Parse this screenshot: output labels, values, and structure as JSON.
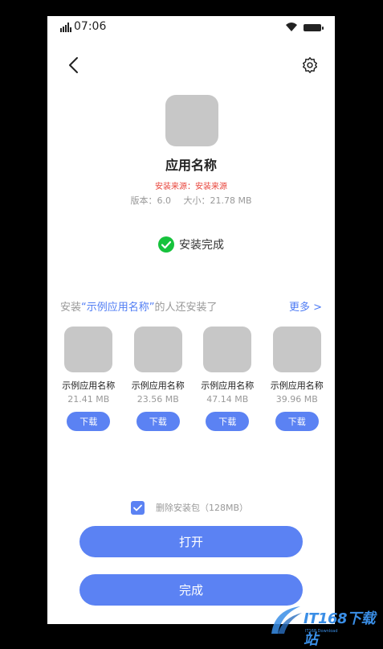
{
  "statusbar": {
    "time": "07:06"
  },
  "app": {
    "name": "应用名称",
    "source": "安装来源：安装来源",
    "version": "版本：6.0",
    "size": "大小：21.78 MB"
  },
  "install_status": "安装完成",
  "recommend": {
    "title_prefix": "安装",
    "title_highlight": "“示例应用名称”",
    "title_suffix": "的人还安装了",
    "more_label": "更多 >",
    "items": [
      {
        "name": "示例应用名称",
        "size": "21.41 MB",
        "button": "下载"
      },
      {
        "name": "示例应用名称",
        "size": "23.56 MB",
        "button": "下载"
      },
      {
        "name": "示例应用名称",
        "size": "47.14 MB",
        "button": "下载"
      },
      {
        "name": "示例应用名称",
        "size": "39.96 MB",
        "button": "下载"
      }
    ]
  },
  "delete_package": {
    "label": "删除安装包（128MB）",
    "checked": true
  },
  "buttons": {
    "open": "打开",
    "done": "完成"
  },
  "watermark": {
    "text": "IT168下载站",
    "sub": "IT168 Download"
  },
  "colors": {
    "accent": "#5b82f3",
    "success": "#16c23c",
    "warning": "#e8453c"
  }
}
